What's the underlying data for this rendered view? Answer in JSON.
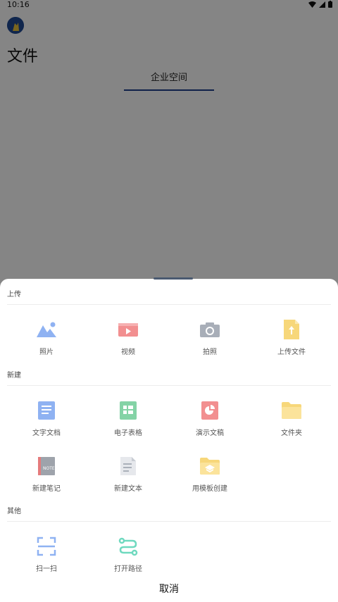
{
  "status": {
    "time": "10:16"
  },
  "background": {
    "page_title": "文件",
    "tab_label": "企业空间"
  },
  "sheet": {
    "sections": [
      {
        "label": "上传",
        "items": [
          {
            "label": "照片",
            "icon": "photo-icon",
            "color": "#8fb2f2"
          },
          {
            "label": "视频",
            "icon": "video-icon",
            "color": "#f28f90"
          },
          {
            "label": "拍照",
            "icon": "camera-icon",
            "color": "#a8aeb8"
          },
          {
            "label": "上传文件",
            "icon": "upload-file-icon",
            "color": "#f7d77a"
          }
        ]
      },
      {
        "label": "新建",
        "items": [
          {
            "label": "文字文档",
            "icon": "text-document-icon",
            "color": "#8fb2f2"
          },
          {
            "label": "电子表格",
            "icon": "spreadsheet-icon",
            "color": "#84d3a6"
          },
          {
            "label": "演示文稿",
            "icon": "presentation-icon",
            "color": "#f28f90"
          },
          {
            "label": "文件夹",
            "icon": "folder-icon",
            "color": "#f7d77a"
          },
          {
            "label": "新建笔记",
            "icon": "note-icon",
            "color": "#9ea3ab"
          },
          {
            "label": "新建文本",
            "icon": "text-file-icon",
            "color": "#d5d8de"
          },
          {
            "label": "用模板创建",
            "icon": "template-icon",
            "color": "#f7d77a"
          }
        ]
      },
      {
        "label": "其他",
        "items": [
          {
            "label": "扫一扫",
            "icon": "scan-icon",
            "color": "#8fb2f2"
          },
          {
            "label": "打开路径",
            "icon": "path-icon",
            "color": "#6fd9bf"
          }
        ]
      }
    ],
    "cancel_label": "取消"
  }
}
